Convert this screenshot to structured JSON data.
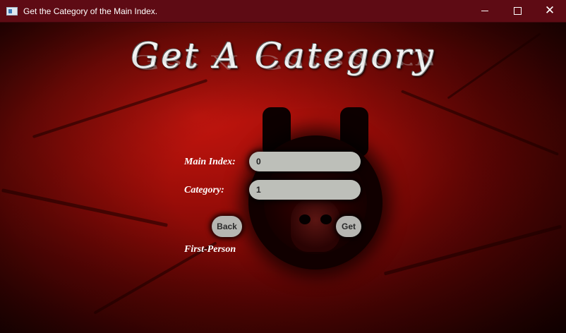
{
  "window": {
    "title": "Get the Category of the Main Index.",
    "controls": {
      "minimize": "minimize",
      "maximize": "maximize",
      "close": "close"
    }
  },
  "heading": "Get A Category",
  "form": {
    "main_index_label": "Main Index:",
    "main_index_value": "0",
    "category_label": "Category:",
    "category_value": "1"
  },
  "buttons": {
    "back_label": "Back",
    "get_label": "Get"
  },
  "result_text": "First-Person",
  "icons": {
    "app": "app-window-icon",
    "minimize": "minimize-icon",
    "maximize": "maximize-icon",
    "close": "close-icon"
  },
  "colors": {
    "titlebar": "#5e0b14",
    "background_red": "#9a0d08",
    "field_bg": "#bdbfb9",
    "text": "#ffffff"
  }
}
